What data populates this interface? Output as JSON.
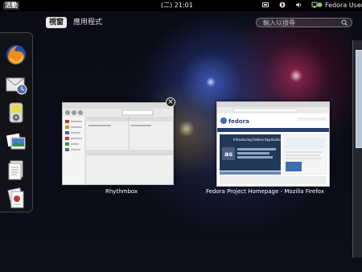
{
  "topbar": {
    "activities": "活動",
    "clock": "(二) 21:01",
    "user": "Fedora User",
    "icons": [
      "network-icon",
      "bluetooth-icon",
      "volume-icon",
      "power-icon"
    ]
  },
  "tabs": [
    {
      "label": "視窗",
      "active": true
    },
    {
      "label": "應用程式",
      "active": false
    }
  ],
  "search": {
    "placeholder": "輸入以搜尋"
  },
  "dash": [
    "firefox-icon",
    "mail-icon",
    "audio-player-icon",
    "photos-icon",
    "documents-icon",
    "office-icon"
  ],
  "windows": [
    {
      "caption": "Rhythmbox"
    },
    {
      "caption": "Fedora Project Homepage - Mozilla Firefox"
    }
  ],
  "browser_page": {
    "brand": "fedora",
    "banner_title": "Introducing Fedora Application Server!",
    "banner_logo": "as"
  }
}
